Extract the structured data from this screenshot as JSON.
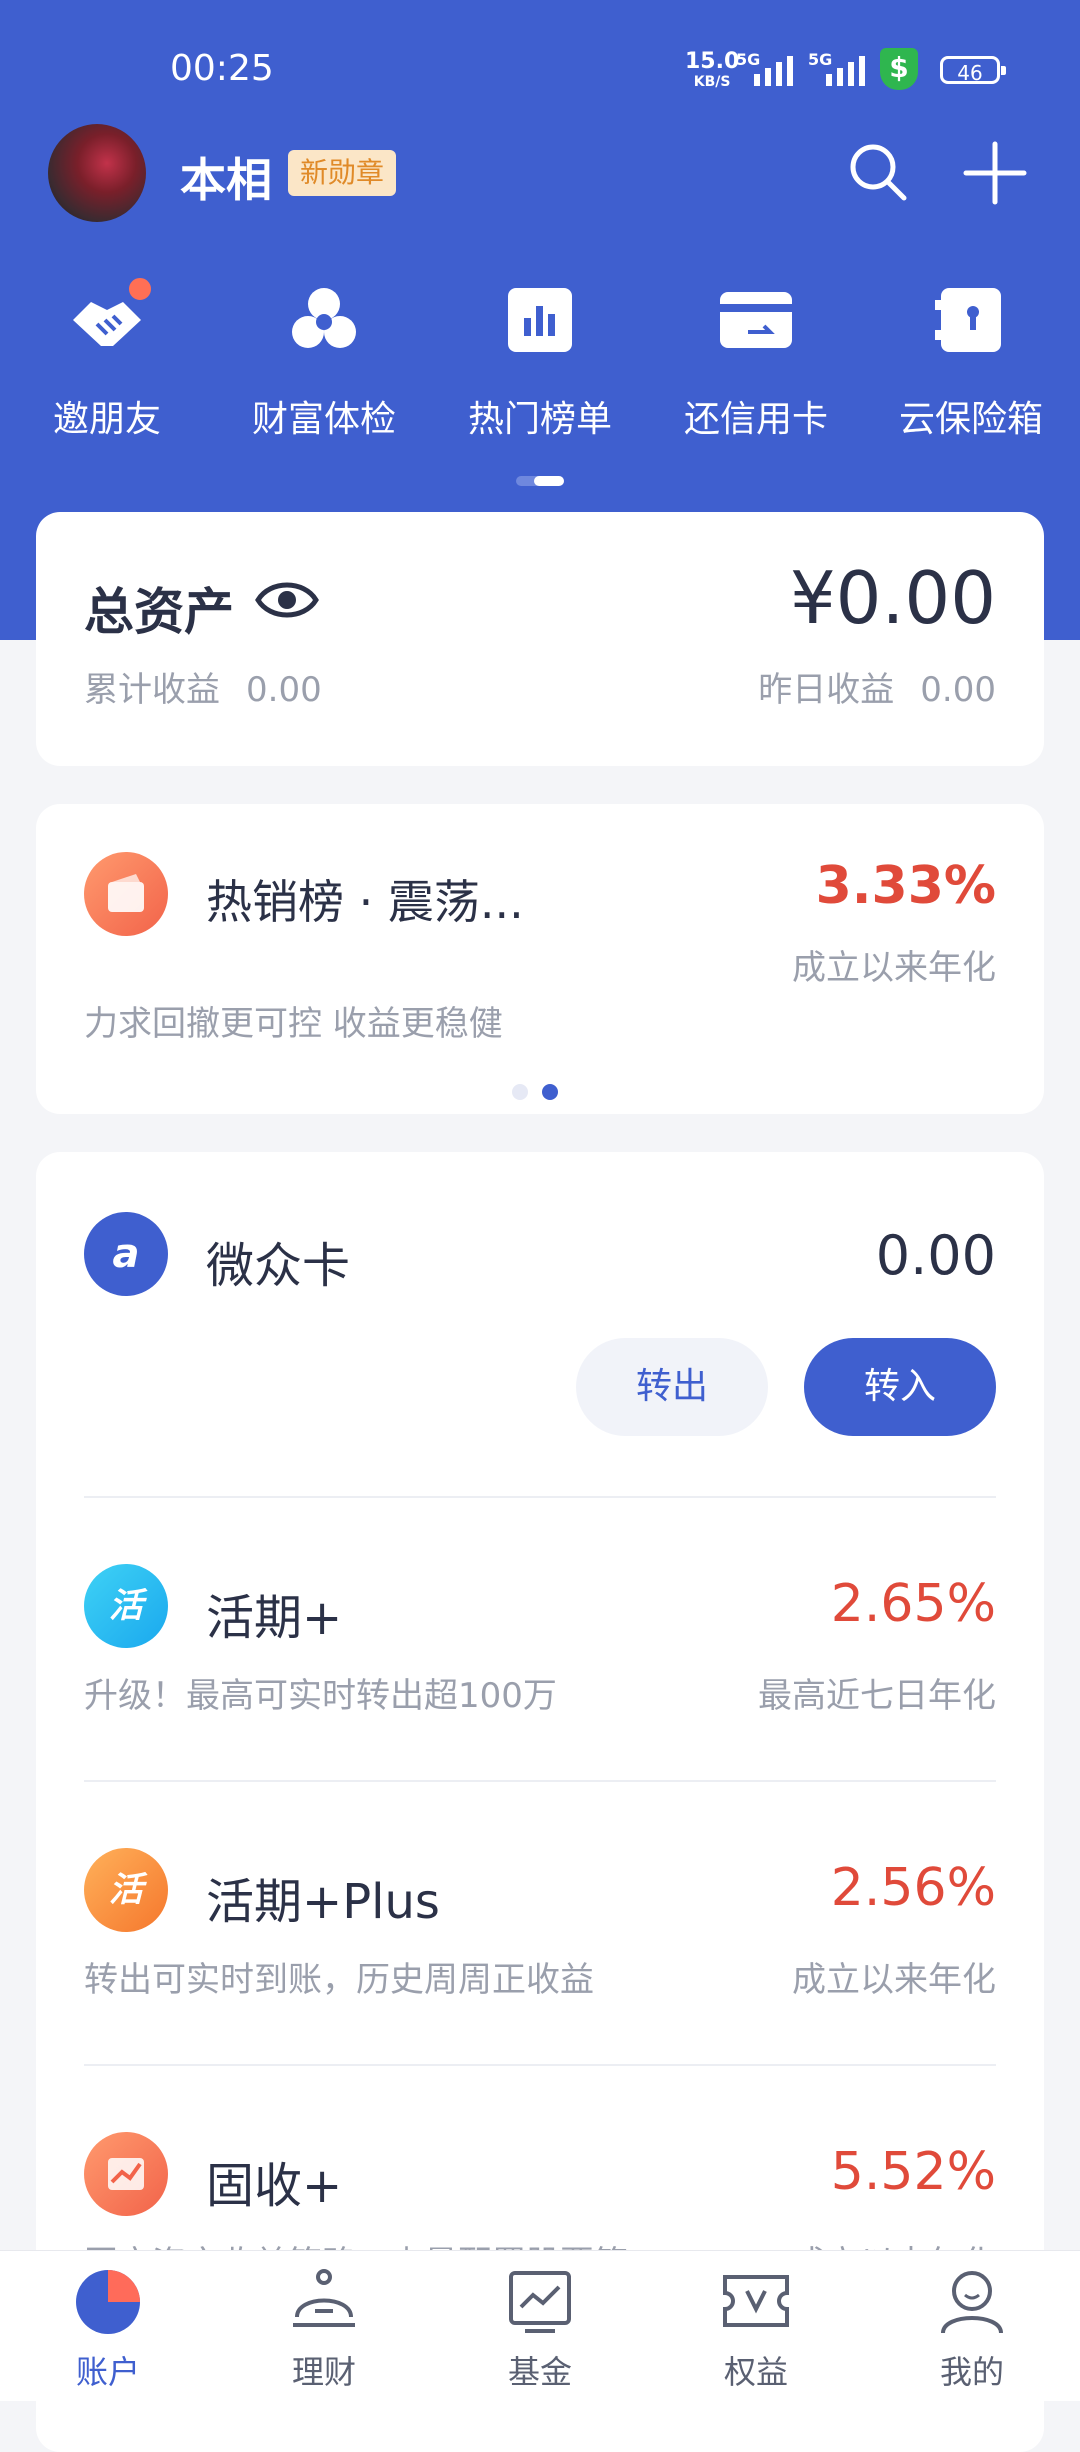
{
  "status_bar": {
    "time": "00:25",
    "net_speed": "15.0",
    "net_unit": "KB/S",
    "signal1": "5G",
    "signal2": "5G",
    "battery": "46"
  },
  "header": {
    "user_name": "本相",
    "badge": "新勋章"
  },
  "quick_menu": [
    {
      "label": "邀朋友",
      "icon": "handshake-icon"
    },
    {
      "label": "财富体检",
      "icon": "wealth-check-icon"
    },
    {
      "label": "热门榜单",
      "icon": "ranking-icon"
    },
    {
      "label": "还信用卡",
      "icon": "credit-card-icon"
    },
    {
      "label": "云保险箱",
      "icon": "safe-box-icon"
    }
  ],
  "assets": {
    "title": "总资产",
    "value": "¥0.00",
    "cumulative_label": "累计收益",
    "cumulative_value": "0.00",
    "yesterday_label": "昨日收益",
    "yesterday_value": "0.00"
  },
  "promo": {
    "title": "热销榜 · 震荡...",
    "rate": "3.33%",
    "rate_label": "成立以来年化",
    "desc": "力求回撤更可控 收益更稳健"
  },
  "weizhong": {
    "name": "微众卡",
    "value": "0.00",
    "out_label": "转出",
    "in_label": "转入"
  },
  "products": [
    {
      "name": "活期+",
      "icon_text": "活",
      "rate": "2.65%",
      "desc": "升级！最高可实时转出超100万",
      "rate_label": "最高近七日年化",
      "color_from": "#3fd2f5",
      "color_to": "#1aa8ee"
    },
    {
      "name": "活期+Plus",
      "icon_text": "活",
      "rate": "2.56%",
      "desc": "转出可实时到账，历史周周正收益",
      "rate_label": "成立以来年化",
      "color_from": "#ffb15a",
      "color_to": "#f5772d"
    },
    {
      "name": "固收+",
      "icon_text": "",
      "rate": "5.52%",
      "desc": "固守资产收益策略，少量配置股票等",
      "rate_label": "成立以来年化",
      "color_from": "#ff9a6e",
      "color_to": "#f2634a"
    }
  ],
  "bottom_nav": [
    {
      "label": "账户",
      "active": true
    },
    {
      "label": "理财",
      "active": false
    },
    {
      "label": "基金",
      "active": false
    },
    {
      "label": "权益",
      "active": false
    },
    {
      "label": "我的",
      "active": false
    }
  ],
  "colors": {
    "primary": "#3f5fcf",
    "rate_red": "#e04a3a"
  }
}
